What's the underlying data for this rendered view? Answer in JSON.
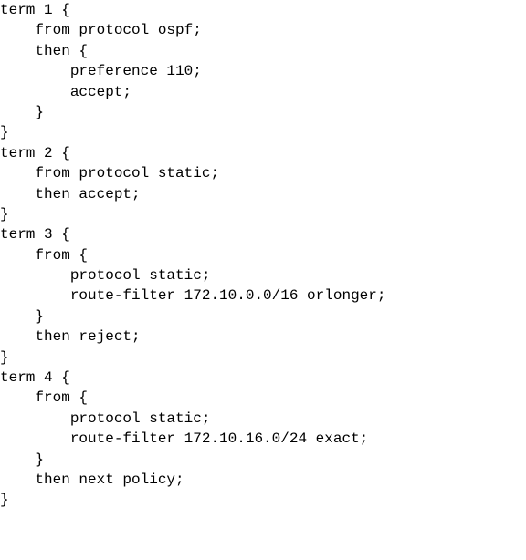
{
  "lines": [
    "term 1 {",
    "    from protocol ospf;",
    "    then {",
    "        preference 110;",
    "        accept;",
    "    }",
    "}",
    "term 2 {",
    "    from protocol static;",
    "    then accept;",
    "}",
    "term 3 {",
    "    from {",
    "        protocol static;",
    "        route-filter 172.10.0.0/16 orlonger;",
    "    }",
    "    then reject;",
    "}",
    "term 4 {",
    "    from {",
    "        protocol static;",
    "        route-filter 172.10.16.0/24 exact;",
    "    }",
    "    then next policy;",
    "}"
  ]
}
